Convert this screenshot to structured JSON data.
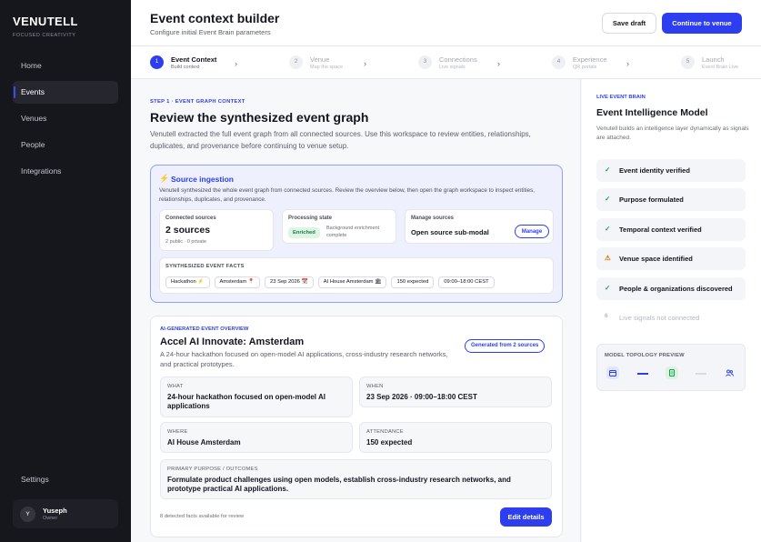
{
  "sidebar": {
    "brand": "VENUTELL",
    "tagline": "FOCUSED CREATIVITY",
    "items": [
      {
        "label": "Home"
      },
      {
        "label": "Events"
      },
      {
        "label": "Venues"
      },
      {
        "label": "People"
      },
      {
        "label": "Integrations"
      }
    ],
    "active_item": "Events",
    "settings_label": "Settings",
    "user": {
      "initial": "Y",
      "name": "Yuseph",
      "role": "Owner"
    }
  },
  "header": {
    "title": "Event context builder",
    "subtitle": "Configure initial Event Brain parameters",
    "save_draft_label": "Save draft",
    "continue_label": "Continue to venue"
  },
  "stepper": [
    {
      "num": "1",
      "label": "Event Context",
      "sub": "Build context"
    },
    {
      "num": "2",
      "label": "Venue",
      "sub": "Map the space"
    },
    {
      "num": "3",
      "label": "Connections",
      "sub": "Live signals"
    },
    {
      "num": "4",
      "label": "Experience",
      "sub": "QR portals"
    },
    {
      "num": "5",
      "label": "Launch",
      "sub": "Event Brain Live"
    }
  ],
  "main": {
    "eyebrow": "STEP 1 · EVENT GRAPH CONTEXT",
    "title": "Review the synthesized event graph",
    "intro": "Venutell extracted the full event graph from all connected sources. Use this workspace to review entities, relationships, duplicates, and provenance before continuing to venue setup.",
    "ingestion": {
      "title": "Source ingestion",
      "desc": "Venutell synthesized the whole event graph from connected sources. Review the overview below, then open the graph workspace to inspect entities, relationships, duplicates, and provenance.",
      "connected": {
        "label": "Connected sources",
        "value": "2 sources",
        "sub": "2 public · 0 private"
      },
      "processing": {
        "label": "Processing state",
        "badge": "Enriched",
        "desc": "Background enrichment complete"
      },
      "manage": {
        "label": "Manage sources",
        "value": "Open source sub-modal",
        "button": "Manage"
      },
      "facts_label": "SYNTHESIZED EVENT FACTS",
      "chips": [
        "Hackathon ⚡",
        "Amsterdam 📍",
        "23 Sep 2026 📆",
        "AI House Amsterdam 🏛",
        "150 expected",
        "09:00–18:00 CEST"
      ]
    },
    "overview": {
      "eyebrow": "AI-GENERATED EVENT OVERVIEW",
      "title": "Accel AI Innovate: Amsterdam",
      "desc": "A 24-hour hackathon focused on open-model AI applications, cross-industry research networks, and practical prototypes.",
      "badge": "Generated from 2 sources",
      "what": {
        "label": "WHAT",
        "value": "24-hour hackathon focused on open-model AI applications"
      },
      "when": {
        "label": "WHEN",
        "value": "23 Sep 2026 · 09:00–18:00 CEST"
      },
      "where": {
        "label": "WHERE",
        "value": "AI House Amsterdam"
      },
      "attendance": {
        "label": "ATTENDANCE",
        "value": "150 expected"
      },
      "purpose": {
        "label": "PRIMARY PURPOSE / OUTCOMES",
        "value": "Formulate product challenges using open models, establish cross-industry research networks, and prototype practical AI applications."
      },
      "footer": "8 detected facts available for review",
      "edit_label": "Edit details"
    }
  },
  "brain": {
    "eyebrow": "LIVE EVENT BRAIN",
    "title": "Event Intelligence Model",
    "desc": "Venutell builds an intelligence layer dynamically as signals are attached.",
    "checks": [
      {
        "label": "Event identity verified",
        "status": "ok",
        "icon": "✓"
      },
      {
        "label": "Purpose formulated",
        "status": "ok",
        "icon": "✓"
      },
      {
        "label": "Temporal context verified",
        "status": "ok",
        "icon": "✓"
      },
      {
        "label": "Venue space identified",
        "status": "warn",
        "icon": "⚠"
      },
      {
        "label": "People & organizations discovered",
        "status": "ok",
        "icon": "✓"
      },
      {
        "label": "Live signals not connected",
        "status": "off",
        "icon": "6"
      }
    ],
    "topology_label": "MODEL TOPOLOGY PREVIEW",
    "topology_nodes": [
      "calendar-icon",
      "document-icon",
      "people-icon"
    ],
    "colors": {
      "accent": "#2d3ef0",
      "ok": "#16a34a",
      "warn": "#d97706"
    }
  }
}
